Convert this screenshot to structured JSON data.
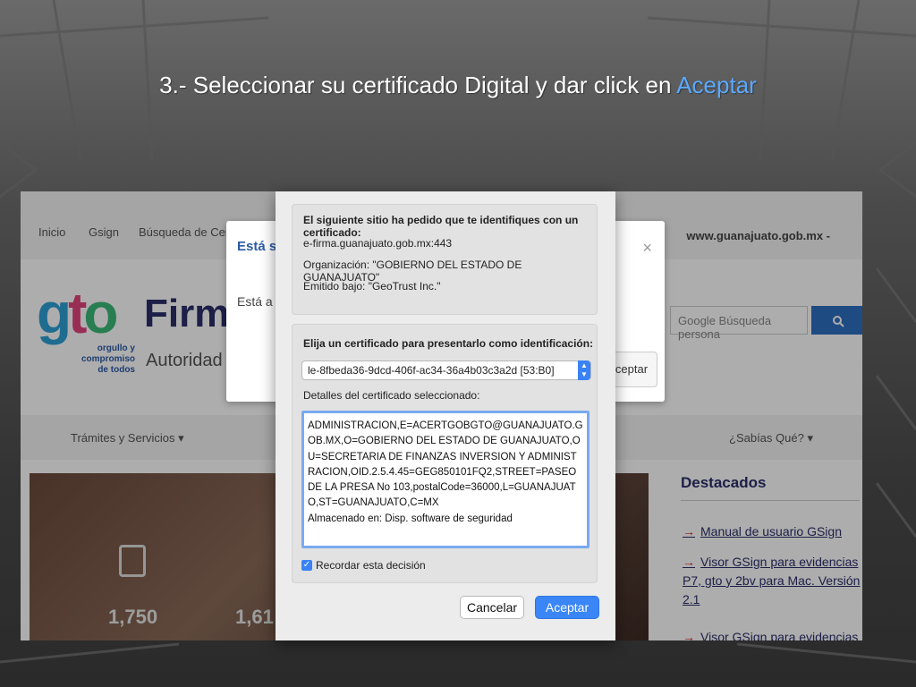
{
  "slide": {
    "title_prefix": "3.- Seleccionar su certificado Digital y dar click en ",
    "title_accent": "Aceptar"
  },
  "website": {
    "nav": [
      "Inicio",
      "Gsign",
      "Búsqueda de Cert"
    ],
    "site_label": "www.guanajuato.gob.mx -",
    "logo_text": "gto",
    "logo_tagline": "orgullo y\ncompromiso\nde todos",
    "brand_title": "Firma",
    "brand_subtitle": "Autoridad Ce",
    "search_placeholder": "Google Búsqueda persona",
    "search_icon": "magnifier-icon",
    "menu_left": "Trámites y Servicios ▾",
    "menu_right": "¿Sabías Qué? ▾",
    "stats": [
      "1,750",
      "1,61"
    ],
    "featured_title": "Destacados",
    "featured_items": [
      "Manual de usuario GSign",
      "Visor GSign para evidencias P7, gto y 2bv para Mac. Versión 2.1",
      "Visor GSign para evidencias"
    ]
  },
  "background_dialog": {
    "title": "Está sa",
    "body": "Está a p",
    "close": "×",
    "accept_partial": "ceptar"
  },
  "cert_sheet": {
    "request_heading": "El siguiente sitio ha pedido que te identifiques con un certificado:",
    "site": "e-firma.guanajuato.gob.mx:443",
    "organization": "Organización: \"GOBIERNO DEL ESTADO DE GUANAJUATO\"",
    "issued_by": "Emitido bajo: \"GeoTrust Inc.\"",
    "choose_heading": "Elija un certificado para presentarlo como identificación:",
    "selected_certificate": "le-8fbeda36-9dcd-406f-ac34-36a4b03c3a2d [53:B0]",
    "details_label": "Detalles del certificado seleccionado:",
    "details_text": "ADMINISTRACION,E=ACERTGOBGTO@GUANAJUATO.GOB.MX,O=GOBIERNO DEL ESTADO DE GUANAJUATO,OU=SECRETARIA DE FINANZAS INVERSION Y ADMINISTRACION,OID.2.5.4.45=GEG850101FQ2,STREET=PASEO DE LA PRESA No 103,postalCode=36000,L=GUANAJUATO,ST=GUANAJUATO,C=MX\nAlmacenado en: Disp. software de seguridad",
    "remember_label": "Recordar esta decisión",
    "remember_checked": true,
    "cancel_label": "Cancelar",
    "accept_label": "Aceptar",
    "accent_color": "#3a86f7"
  }
}
